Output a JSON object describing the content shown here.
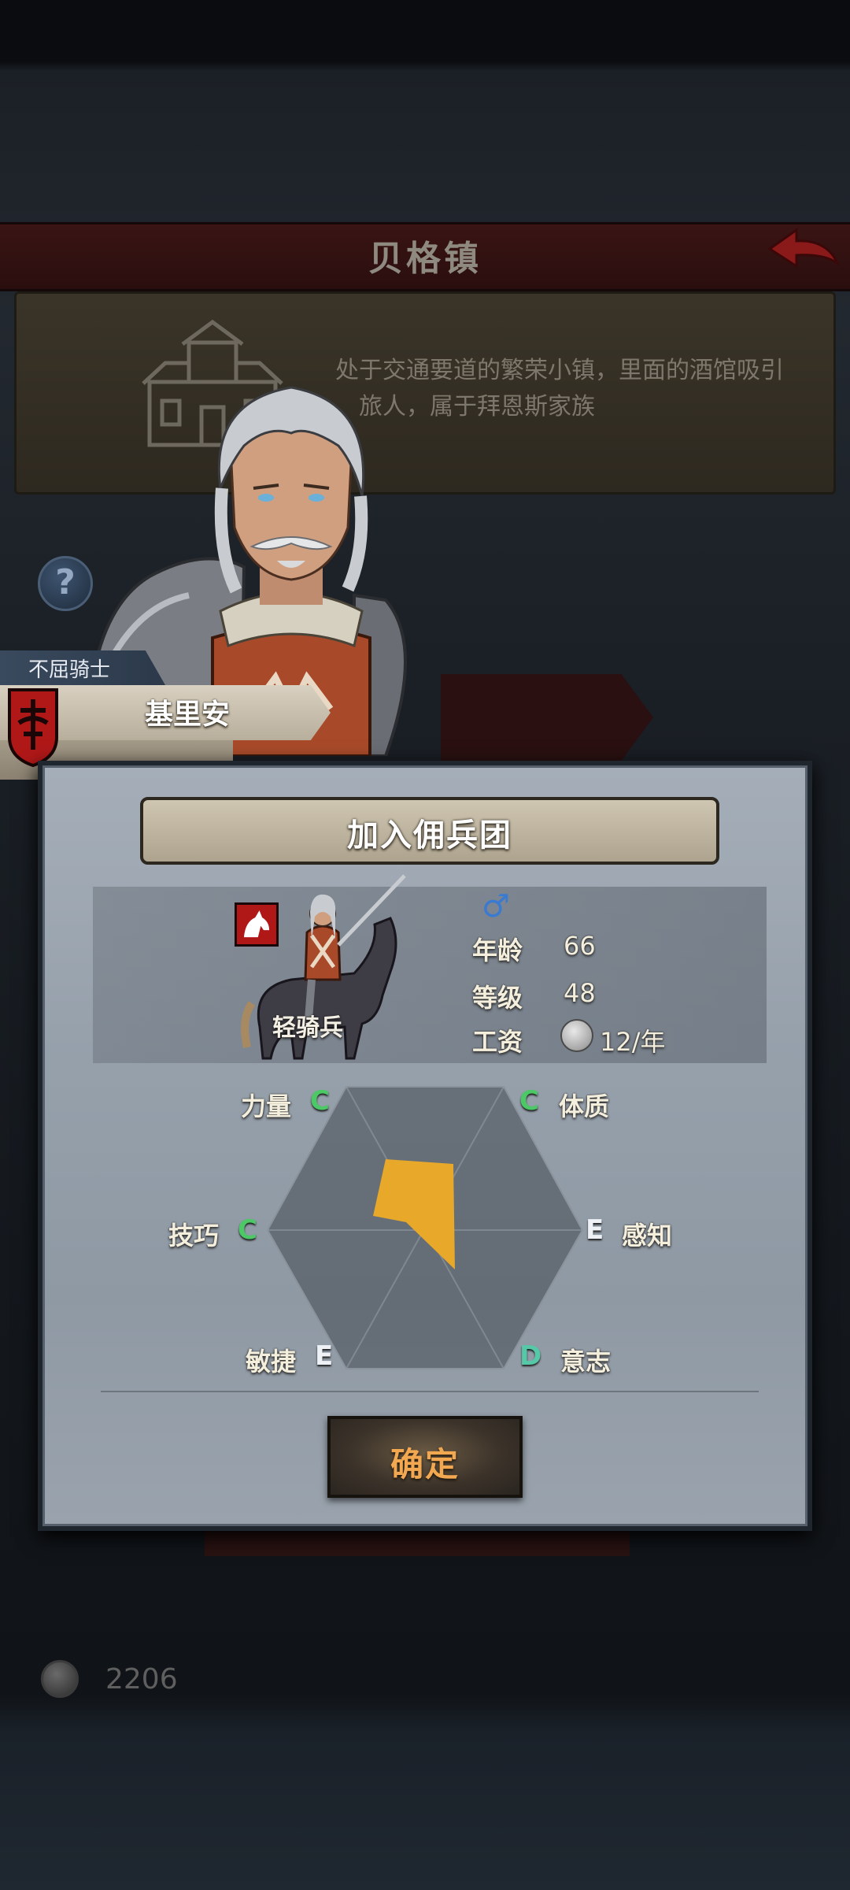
{
  "town": {
    "title": "贝格镇",
    "description_line1": "处于交通要道的繁荣小镇，里面的酒馆吸引",
    "description_line2": "旅人，属于拜恩斯家族"
  },
  "help_icon_glyph": "?",
  "character": {
    "title_tag": "不屈骑士",
    "name": "基里安"
  },
  "dialog": {
    "title": "加入佣兵团",
    "unit_class": "轻骑兵",
    "gender_glyph": "♂",
    "stats": {
      "age_label": "年龄",
      "age_value": "66",
      "level_label": "等级",
      "level_value": "48",
      "wage_label": "工资",
      "wage_value": "12/年"
    },
    "attributes": {
      "strength": {
        "label": "力量",
        "grade": "C"
      },
      "constitution": {
        "label": "体质",
        "grade": "C"
      },
      "skill": {
        "label": "技巧",
        "grade": "C"
      },
      "perception": {
        "label": "感知",
        "grade": "E"
      },
      "agility": {
        "label": "敏捷",
        "grade": "E"
      },
      "will": {
        "label": "意志",
        "grade": "D"
      }
    },
    "confirm_label": "确定"
  },
  "currency": {
    "amount": "2206"
  },
  "colors": {
    "grade_c": "#4cc866",
    "grade_d": "#56c8a8",
    "grade_e": "#eef2f6",
    "radar_fill": "#e8a82a",
    "confirm_text": "#f2a850"
  }
}
